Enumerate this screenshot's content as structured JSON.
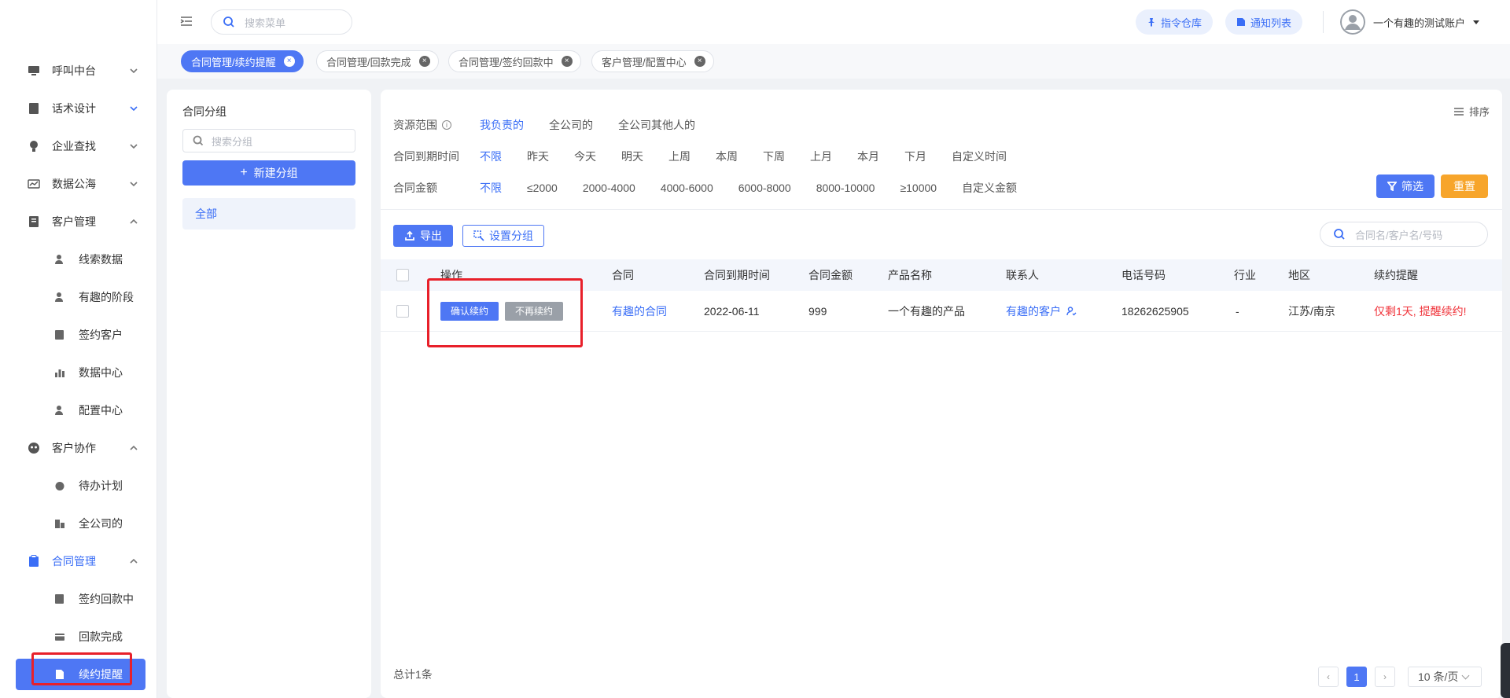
{
  "header": {
    "search_placeholder": "搜索菜单",
    "btn_command": "指令仓库",
    "btn_notify": "通知列表",
    "user_name": "一个有趣的测试账户"
  },
  "sidebar": {
    "items": [
      {
        "label": "呼叫中台",
        "icon": "monitor-icon",
        "expanded": false
      },
      {
        "label": "话术设计",
        "icon": "book-icon",
        "expanded": false
      },
      {
        "label": "企业查找",
        "icon": "bulb-icon",
        "expanded": false
      },
      {
        "label": "数据公海",
        "icon": "chart-icon",
        "expanded": false
      },
      {
        "label": "客户管理",
        "icon": "contacts-icon",
        "expanded": true,
        "children": [
          "线索数据",
          "有趣的阶段",
          "签约客户",
          "数据中心",
          "配置中心"
        ]
      },
      {
        "label": "客户协作",
        "icon": "team-icon",
        "expanded": true,
        "children": [
          "待办计划",
          "全公司的"
        ]
      },
      {
        "label": "合同管理",
        "icon": "clipboard-icon",
        "expanded": true,
        "children": [
          "签约回款中",
          "回款完成",
          "续约提醒"
        ]
      }
    ],
    "active": "续约提醒"
  },
  "tabs": [
    {
      "label": "合同管理/续约提醒",
      "active": true
    },
    {
      "label": "合同管理/回款完成",
      "active": false
    },
    {
      "label": "合同管理/签约回款中",
      "active": false
    },
    {
      "label": "客户管理/配置中心",
      "active": false
    }
  ],
  "group_panel": {
    "title": "合同分组",
    "search_placeholder": "搜索分组",
    "new_button": "新建分组",
    "all_label": "全部"
  },
  "filters": {
    "sort_label": "排序",
    "scope": {
      "label": "资源范围",
      "options": [
        "我负责的",
        "全公司的",
        "全公司其他人的"
      ],
      "selected": 0
    },
    "expire": {
      "label": "合同到期时间",
      "options": [
        "不限",
        "昨天",
        "今天",
        "明天",
        "上周",
        "本周",
        "下周",
        "上月",
        "本月",
        "下月",
        "自定义时间"
      ],
      "selected": 0
    },
    "amount": {
      "label": "合同金额",
      "options": [
        "不限",
        "≤2000",
        "2000-4000",
        "4000-6000",
        "6000-8000",
        "8000-10000",
        "≥10000",
        "自定义金额"
      ],
      "selected": 0
    },
    "filter_button": "筛选",
    "reset_button": "重置"
  },
  "toolbar": {
    "export": "导出",
    "set_group": "设置分组",
    "search_placeholder": "合同名/客户名/号码"
  },
  "table": {
    "columns": [
      "操作",
      "合同",
      "合同到期时间",
      "合同金额",
      "产品名称",
      "联系人",
      "电话号码",
      "行业",
      "地区",
      "续约提醒"
    ],
    "rows": [
      {
        "confirm": "确认续约",
        "no_renew": "不再续约",
        "contract": "有趣的合同",
        "expire_date": "2022-06-11",
        "amount": "999",
        "product": "一个有趣的产品",
        "contact": "有趣的客户",
        "phone": "18262625905",
        "industry": "-",
        "region": "江苏/南京",
        "reminder": "仅剩1天, 提醒续约!"
      }
    ]
  },
  "footer": {
    "total": "总计1条",
    "current_page": "1",
    "page_size": "10 条/页"
  },
  "colors": {
    "primary": "#4e77f4",
    "reset": "#f7a52b",
    "reminder": "#f0343b",
    "annotation": "#e8202a"
  }
}
